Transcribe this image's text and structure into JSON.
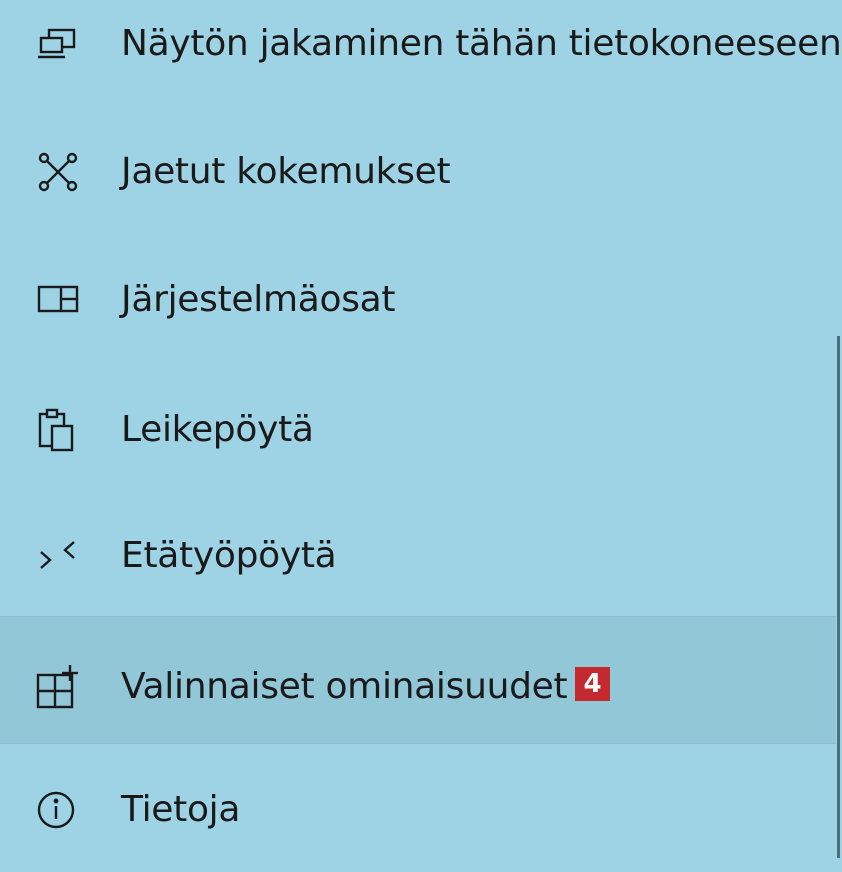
{
  "colors": {
    "background": "#9dd3e4",
    "selected_background": "#92c7d7",
    "badge": "#c3292f",
    "text": "#1a1a1a"
  },
  "nav": {
    "items": [
      {
        "label": "Näytön jakaminen tähän tietokoneeseen",
        "icon": "project-to-pc-icon"
      },
      {
        "label": "Jaetut kokemukset",
        "icon": "shared-experiences-icon"
      },
      {
        "label": "Järjestelmäosat",
        "icon": "system-components-icon"
      },
      {
        "label": "Leikepöytä",
        "icon": "clipboard-icon"
      },
      {
        "label": "Etätyöpöytä",
        "icon": "remote-desktop-icon"
      },
      {
        "label": "Valinnaiset ominaisuudet",
        "icon": "optional-features-icon",
        "selected": true,
        "badge": "4"
      },
      {
        "label": "Tietoja",
        "icon": "info-icon"
      }
    ]
  }
}
